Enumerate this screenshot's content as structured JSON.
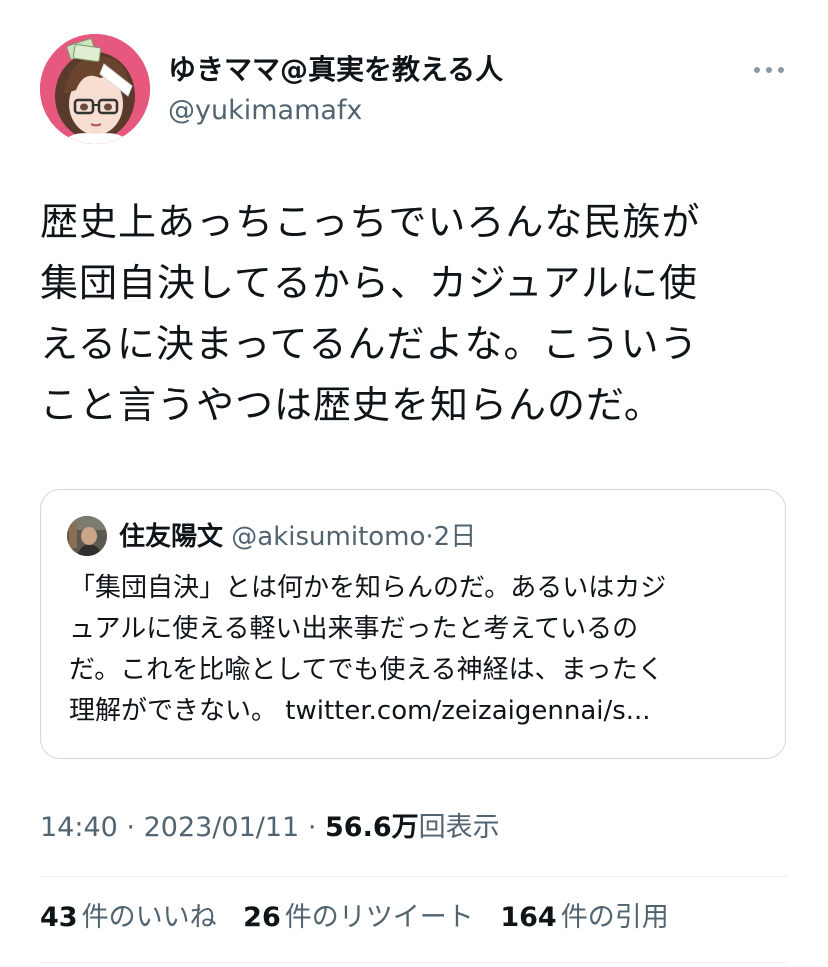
{
  "author": {
    "display_name": "ゆきママ@真実を教える人",
    "handle": "@yukimamafx"
  },
  "tweet": {
    "text": "歴史上あっちこっちでいろんな民族が\n集団自決してるから、カジュアルに使\nえるに決まってるんだよな。こういう\nこと言うやつは歴史を知らんのだ。"
  },
  "quoted_tweet": {
    "author_name": "住友陽文",
    "author_handle": "@akisumitomo",
    "separator": "·",
    "date": "2日",
    "text": "「集団自決」とは何かを知らんのだ。あるいはカジ\nュアルに使える軽い出来事だったと考えているの\nだ。これを比喩としてでも使える神経は、まったく\n理解ができない。 twitter.com/zeizaigennai/s..."
  },
  "meta": {
    "time": "14:40",
    "separator": "·",
    "date": "2023/01/11",
    "views_count": "56.6万",
    "views_label": "回表示"
  },
  "stats": {
    "likes_count": "43",
    "likes_label": "件のいいね",
    "retweets_count": "26",
    "retweets_label": "件のリツイート",
    "quotes_count": "164",
    "quotes_label": "件の引用"
  },
  "icons": {
    "more": "more-icon",
    "avatar": "avatar-image",
    "quote_avatar": "quote-avatar-image"
  },
  "colors": {
    "text_primary": "#0f1419",
    "text_secondary": "#536471",
    "border": "#cfd9de",
    "divider": "#eff3f4",
    "avatar_background": "#e7587f"
  }
}
